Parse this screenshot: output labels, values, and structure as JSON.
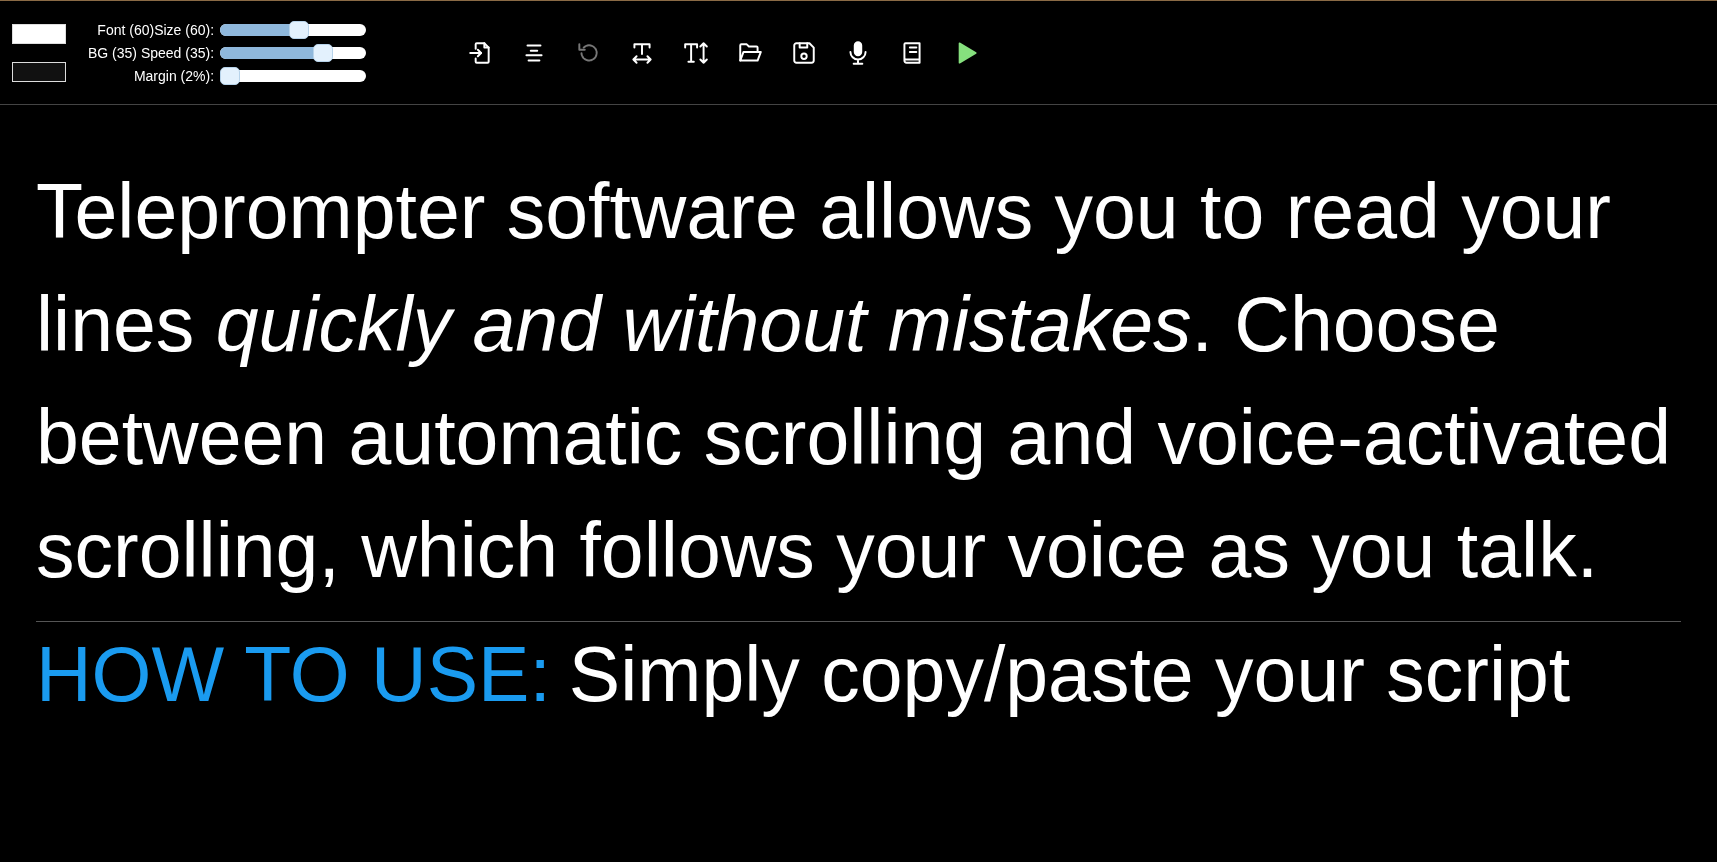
{
  "color_swatches": [
    {
      "color": "#ffffff"
    },
    {
      "color": "#111111"
    }
  ],
  "sliders": [
    {
      "label": "Font (60)Size (60):",
      "level": 0.55
    },
    {
      "label": "BG (35) Speed (35):",
      "level": 0.74
    },
    {
      "label": "Margin (2%):",
      "level": 0.0
    }
  ],
  "toolbar": [
    {
      "kind": "import",
      "disabled": false
    },
    {
      "kind": "align",
      "disabled": false
    },
    {
      "kind": "undo",
      "disabled": true
    },
    {
      "kind": "width",
      "disabled": false
    },
    {
      "kind": "height",
      "disabled": false
    },
    {
      "kind": "open",
      "disabled": false
    },
    {
      "kind": "save",
      "disabled": false
    },
    {
      "kind": "mic",
      "disabled": false
    },
    {
      "kind": "book",
      "disabled": false
    },
    {
      "kind": "play",
      "disabled": false
    }
  ],
  "script": {
    "paragraphs": [
      {
        "kind": "text",
        "text": "Teleprompter software allows you to read your lines *quickly and without mistakes*. Choose between automatic scrolling and voice-activated scrolling, which follows your voice as you talk."
      },
      {
        "kind": "howto",
        "heading": "HOW TO USE:",
        "text": "Simply copy/paste your script"
      }
    ]
  }
}
